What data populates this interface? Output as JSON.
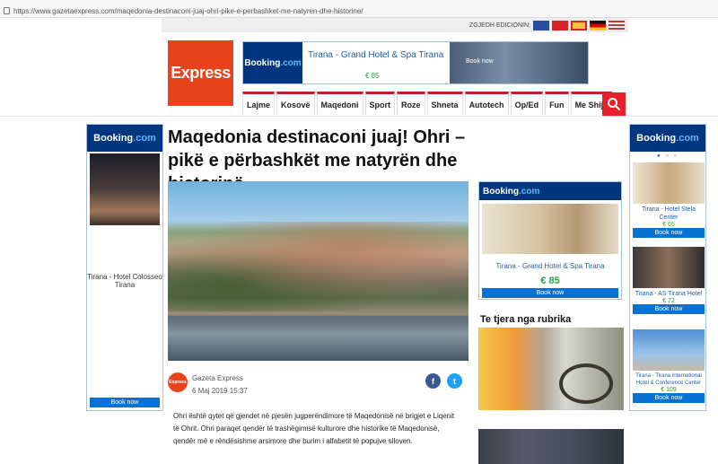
{
  "browser": {
    "url": "https://www.gazetaexpress.com/maqedonia-destinaconi-juaj-ohri-pike-e-perbashket-me-natyren-dhe-historine/",
    "host": "https://www.gazetaexpress.com"
  },
  "lang": {
    "label": "ZGJEDH EDICIONIN:"
  },
  "logo": {
    "text": "Express"
  },
  "top_ad": {
    "brand_a": "Booking",
    "brand_b": ".com",
    "hotel": "Tirana - Grand Hotel & Spa Tirana",
    "price": "€ 85",
    "button": "Book now"
  },
  "nav": {
    "items": [
      "Lajme",
      "Kosovë",
      "Maqedoni",
      "Sport",
      "Roze",
      "Shneta",
      "Autotech",
      "Op/Ed",
      "Fun",
      "Me Shije"
    ]
  },
  "left_ad": {
    "brand_a": "Booking",
    "brand_b": ".com",
    "hotel": "Tirana - Hotel Colosseo Tirana",
    "button": "Book now"
  },
  "article": {
    "title": "Maqedonia destinaconi juaj! Ohri – pikë e përbashkët me natyrën dhe historinë",
    "author": "Gazeta Express",
    "author_logo": "Express",
    "date": "6 Maj 2019 15:37",
    "body": "Ohri është qytet që gjendet në pjesën jugperëndimore të Maqedonisë në brigjet e Liqenit të Ohrit.  Ohri paraqet qendër të trashëgimisë kulturore dhe historike të Maqedonisë, qendër më e rëndësishme arsimore dhe burim i alfabetit të popujve slloven."
  },
  "share": {
    "facebook": "f",
    "twitter": "t"
  },
  "mid_ad": {
    "brand_a": "Booking",
    "brand_b": ".com",
    "hotel": "Tirana - Grand Hotel & Spa Tirana",
    "price": "€ 85",
    "button": "Book now"
  },
  "rubrika": {
    "title": "Te tjera nga rubrika"
  },
  "right_ad": {
    "brand_a": "Booking",
    "brand_b": ".com",
    "dots": "● ○ ○",
    "cards": [
      {
        "name": "Tirana - Hotel Stela Center",
        "price": "€ 65",
        "button": "Book now"
      },
      {
        "name": "Tirana - AS Tirana Hotel",
        "price": "€ 72",
        "button": "Book now"
      },
      {
        "name": "Tirana - Tirana International Hotel & Conference Center",
        "price": "€ 109",
        "button": "Book now"
      }
    ]
  },
  "colors": {
    "brand_red": "#e8431d",
    "booking_blue": "#003580",
    "book_btn": "#0872d3",
    "price_green": "#2aa049"
  }
}
